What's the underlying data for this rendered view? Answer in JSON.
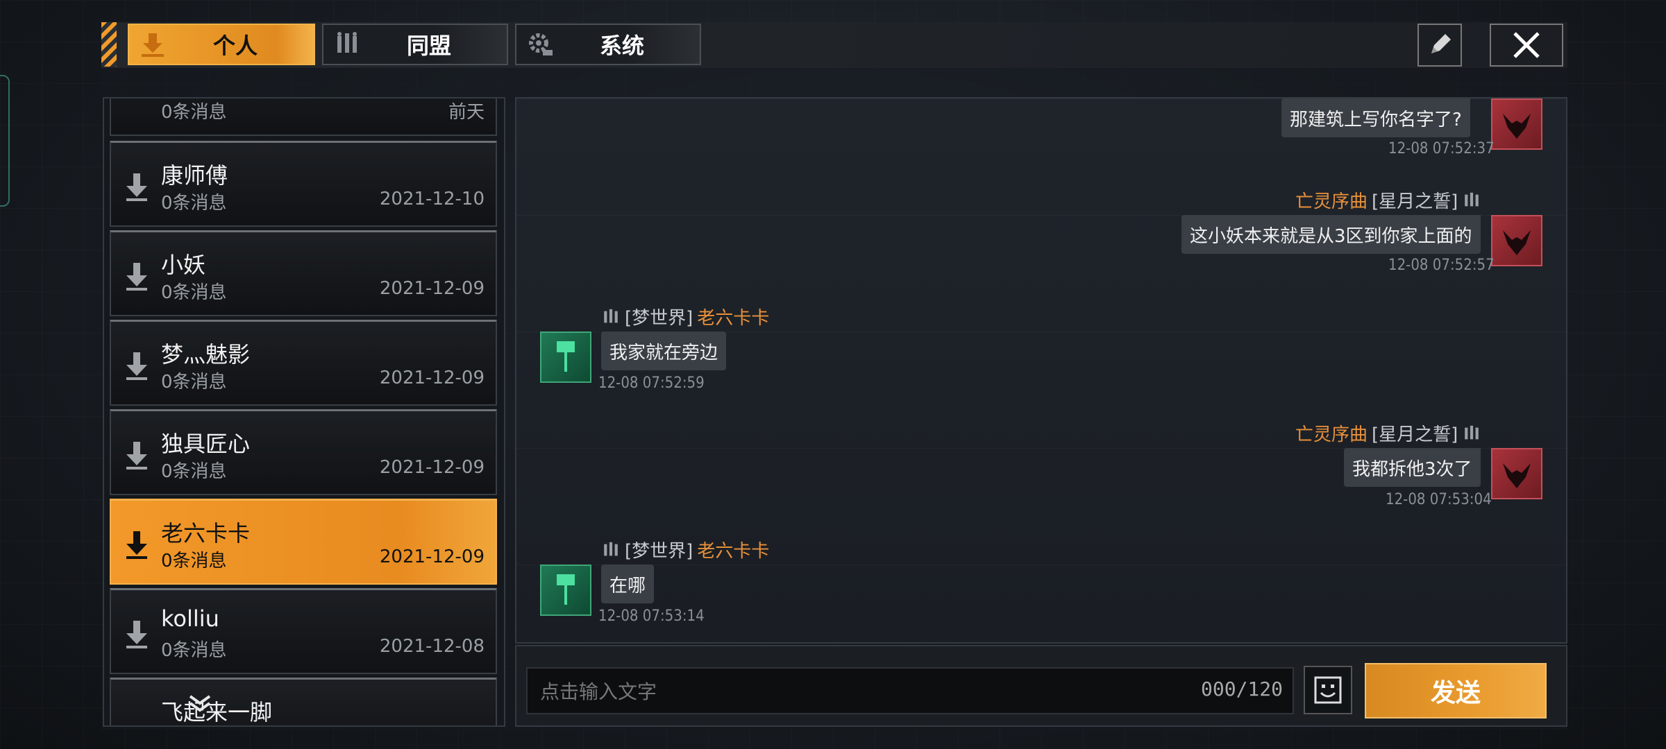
{
  "tabs": [
    {
      "label": "个人",
      "icon": "download-arrow-icon",
      "active": true
    },
    {
      "label": "同盟",
      "icon": "alliance-icon",
      "active": false
    },
    {
      "label": "系统",
      "icon": "gear-icon",
      "active": false
    }
  ],
  "toolbar": {
    "edit_icon": "pencil-icon",
    "close_icon": "close-icon"
  },
  "contacts": [
    {
      "name": "",
      "count": "0条消息",
      "date": "前天",
      "active": false
    },
    {
      "name": "康师傅",
      "count": "0条消息",
      "date": "2021-12-10",
      "active": false
    },
    {
      "name": "小妖",
      "count": "0条消息",
      "date": "2021-12-09",
      "active": false
    },
    {
      "name": "梦灬魅影",
      "count": "0条消息",
      "date": "2021-12-09",
      "active": false
    },
    {
      "name": "独具匠心",
      "count": "0条消息",
      "date": "2021-12-09",
      "active": false
    },
    {
      "name": "老六卡卡",
      "count": "0条消息",
      "date": "2021-12-09",
      "active": true
    },
    {
      "name": "kolliu",
      "count": "0条消息",
      "date": "2021-12-08",
      "active": false
    },
    {
      "name": "飞起来一脚",
      "count": "",
      "date": "",
      "active": false
    }
  ],
  "messages": [
    {
      "side": "right",
      "sender_name": "",
      "sender_alliance": "",
      "text": "那建筑上写你名字了?",
      "time": "12-08 07:52:37"
    },
    {
      "side": "right",
      "sender_name": "亡灵序曲",
      "sender_alliance": "[星月之誓]",
      "text": "这小妖本来就是从3区到你家上面的",
      "time": "12-08 07:52:57"
    },
    {
      "side": "left",
      "sender_name": "老六卡卡",
      "sender_alliance": "[梦世界]",
      "text": "我家就在旁边",
      "time": "12-08 07:52:59"
    },
    {
      "side": "right",
      "sender_name": "亡灵序曲",
      "sender_alliance": "[星月之誓]",
      "text": "我都拆他3次了",
      "time": "12-08 07:53:04"
    },
    {
      "side": "left",
      "sender_name": "老六卡卡",
      "sender_alliance": "[梦世界]",
      "text": "在哪",
      "time": "12-08 07:53:14"
    }
  ],
  "input": {
    "placeholder": "点击输入文字",
    "counter": "000/120"
  },
  "send_label": "发送",
  "colors": {
    "accent": "#f0a531",
    "name_orange": "#e9913a",
    "avatar_red": "#a8323b",
    "avatar_green": "#1f7a55"
  }
}
